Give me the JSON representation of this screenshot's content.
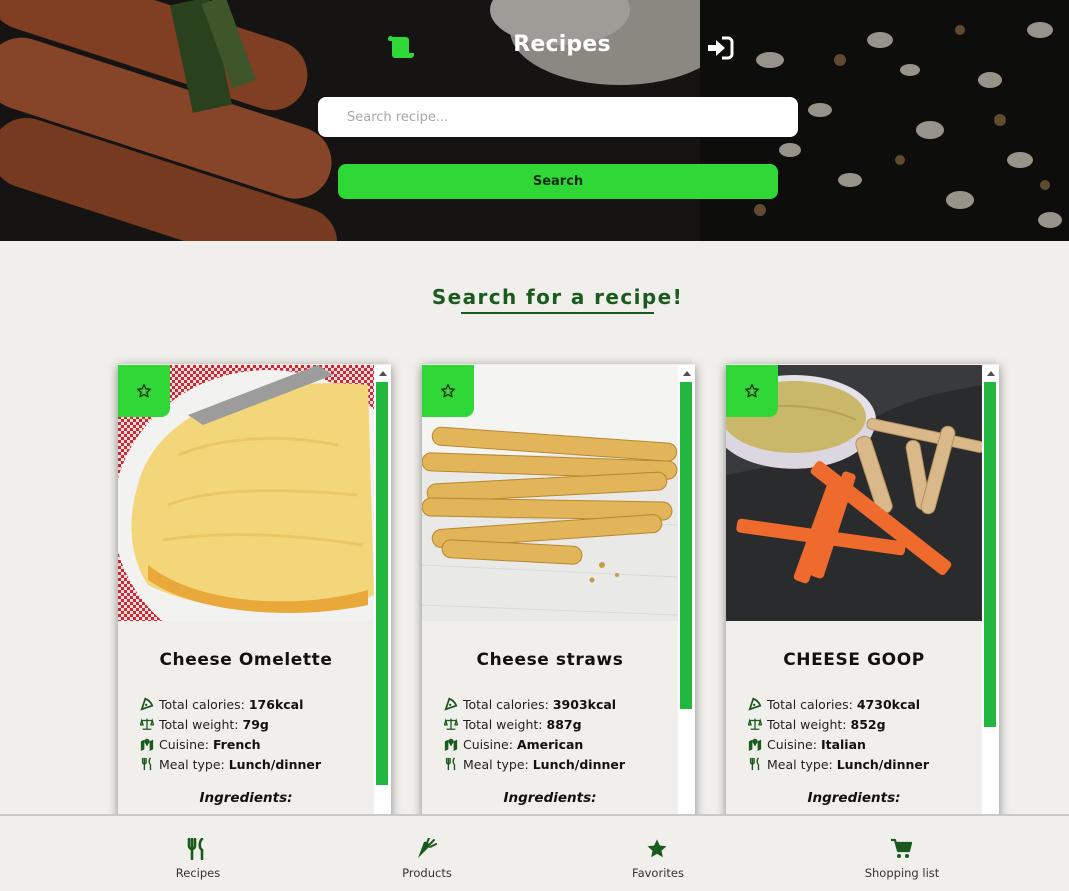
{
  "header": {
    "title": "Recipes",
    "logo_icon": "scroll-icon",
    "login_icon": "sign-in-icon",
    "accent_color": "#2fd836"
  },
  "search": {
    "placeholder": "Search recipe...",
    "value": "",
    "button_label": "Search"
  },
  "main": {
    "heading": "Search for a recipe!"
  },
  "labels": {
    "calories": "Total calories:",
    "weight": "Total weight:",
    "cuisine": "Cuisine:",
    "meal_type": "Meal type:",
    "ingredients": "Ingredients:"
  },
  "recipes": [
    {
      "title": "Cheese Omelette",
      "calories": "176kcal",
      "weight": "79g",
      "cuisine": "French",
      "meal_type": "Lunch/dinner",
      "favorite": false,
      "scroll_fraction": 0.9
    },
    {
      "title": "Cheese straws",
      "calories": "3903kcal",
      "weight": "887g",
      "cuisine": "American",
      "meal_type": "Lunch/dinner",
      "favorite": false,
      "scroll_fraction": 0.73
    },
    {
      "title": "CHEESE GOOP",
      "calories": "4730kcal",
      "weight": "852g",
      "cuisine": "Italian",
      "meal_type": "Lunch/dinner",
      "favorite": false,
      "scroll_fraction": 0.77
    }
  ],
  "bottom_nav": {
    "items": [
      {
        "label": "Recipes",
        "icon": "utensils-icon"
      },
      {
        "label": "Products",
        "icon": "carrot-icon"
      },
      {
        "label": "Favorites",
        "icon": "star-icon"
      },
      {
        "label": "Shopping list",
        "icon": "shopping-cart-icon"
      }
    ]
  }
}
